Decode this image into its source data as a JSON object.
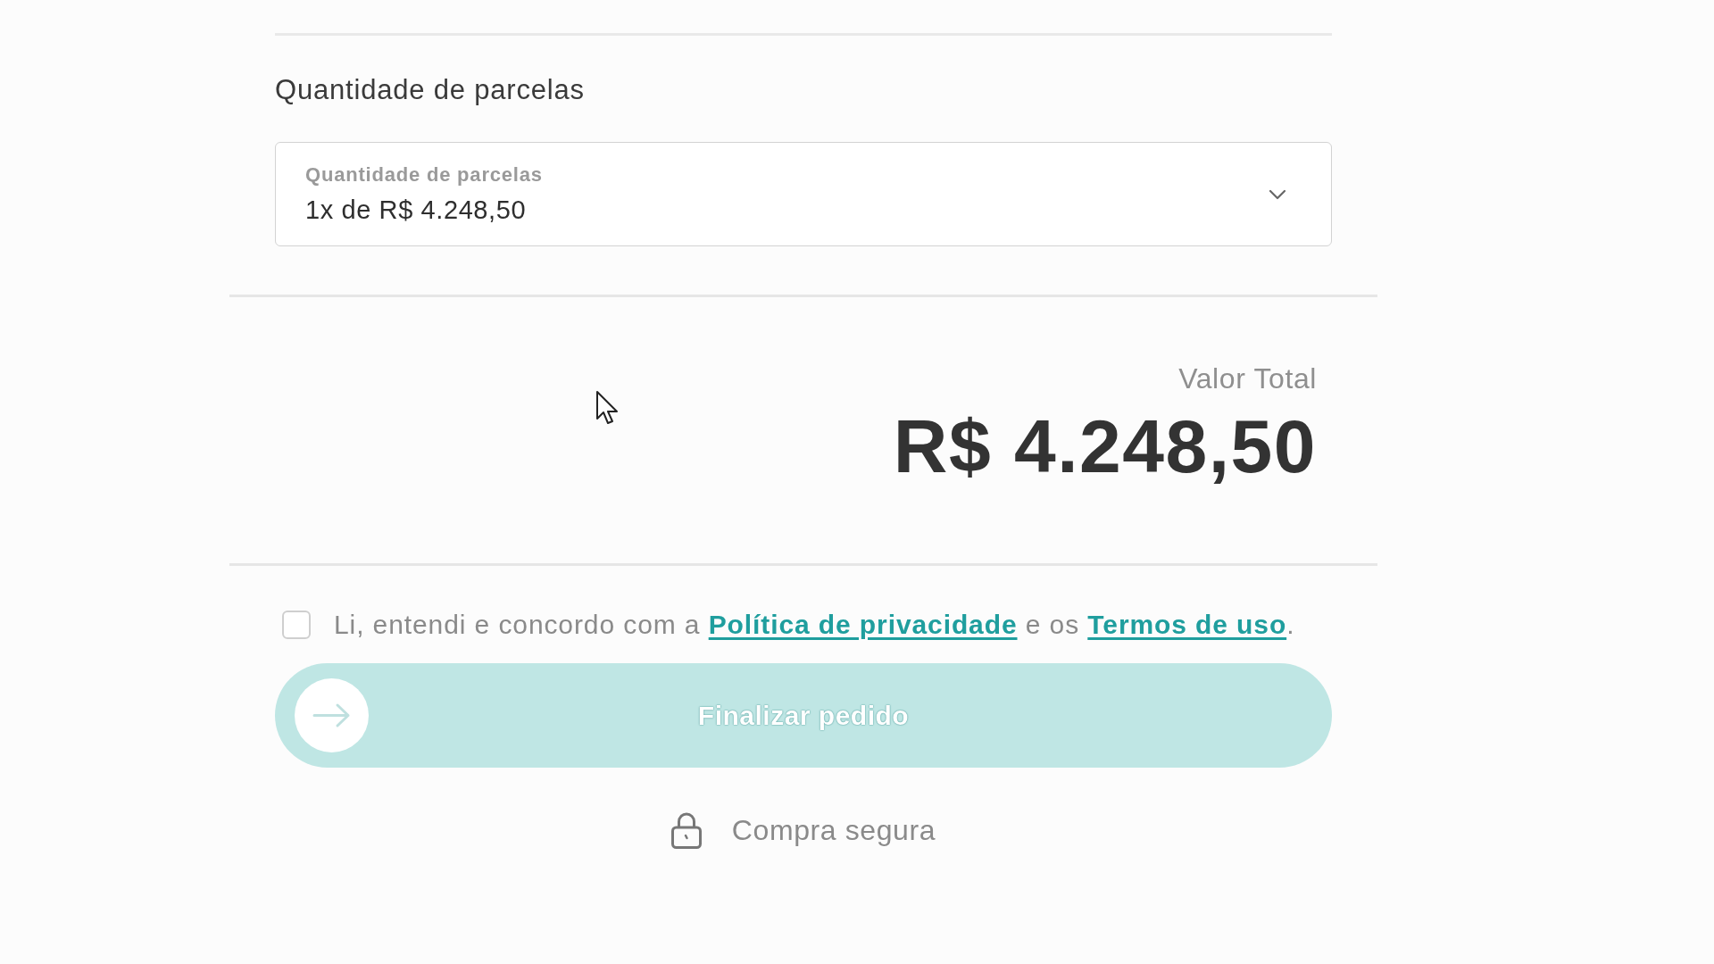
{
  "installments": {
    "heading": "Quantidade de parcelas",
    "select": {
      "label": "Quantidade de parcelas",
      "value": "1x de R$ 4.248,50"
    }
  },
  "total": {
    "label": "Valor Total",
    "amount": "R$ 4.248,50"
  },
  "consent": {
    "checked": false,
    "parts": [
      {
        "kind": "text",
        "text": "Li, entendi e concordo com a "
      },
      {
        "kind": "link",
        "text": "Política de privacidade"
      },
      {
        "kind": "text",
        "text": " e os "
      },
      {
        "kind": "link",
        "text": "Termos de uso"
      },
      {
        "kind": "text",
        "text": "."
      }
    ]
  },
  "submit": {
    "label": "Finalizar pedido",
    "disabled": true
  },
  "secure": {
    "text": "Compra segura"
  }
}
